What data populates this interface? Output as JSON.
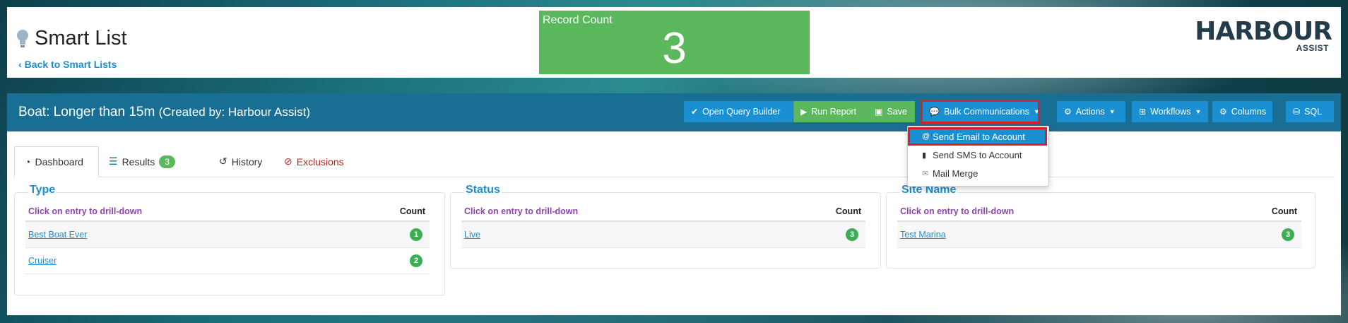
{
  "header": {
    "title": "Smart List",
    "back_link": "Back to Smart Lists",
    "record_count_label": "Record Count",
    "record_count_value": "3",
    "logo_main": "HARBOUR",
    "logo_sub": "ASSIST"
  },
  "card": {
    "title": "Boat: Longer than 15m",
    "created_by": "(Created by: Harbour Assist)",
    "buttons": {
      "open_query_builder": "Open Query Builder",
      "run_report": "Run Report",
      "save": "Save",
      "bulk_communications": "Bulk Communications",
      "actions": "Actions",
      "workflows": "Workflows",
      "columns": "Columns",
      "sql": "SQL"
    }
  },
  "tabs": {
    "dashboard": "Dashboard",
    "results": "Results",
    "results_count": "3",
    "history": "History",
    "exclusions": "Exclusions"
  },
  "panels": [
    {
      "title": "Type",
      "hint": "Click on entry to drill-down",
      "count_header": "Count",
      "rows": [
        {
          "label": "Best Boat Ever",
          "count": "1"
        },
        {
          "label": "Cruiser",
          "count": "2"
        }
      ]
    },
    {
      "title": "Status",
      "hint": "Click on entry to drill-down",
      "count_header": "Count",
      "rows": [
        {
          "label": "Live",
          "count": "3"
        }
      ]
    },
    {
      "title": "Site Name",
      "hint": "Click on entry to drill-down",
      "count_header": "Count",
      "rows": [
        {
          "label": "Test Marina",
          "count": "3"
        }
      ]
    }
  ],
  "dropdown": {
    "items": [
      {
        "label": "Send Email to Account",
        "icon": "at-icon"
      },
      {
        "label": "Send SMS to Account",
        "icon": "mobile-icon"
      },
      {
        "label": "Mail Merge",
        "icon": "envelope-icon"
      }
    ]
  },
  "colors": {
    "header_bar": "#186e93",
    "primary_button": "#1a8fd1",
    "success": "#5cb85c",
    "highlight": "#d8202a"
  }
}
